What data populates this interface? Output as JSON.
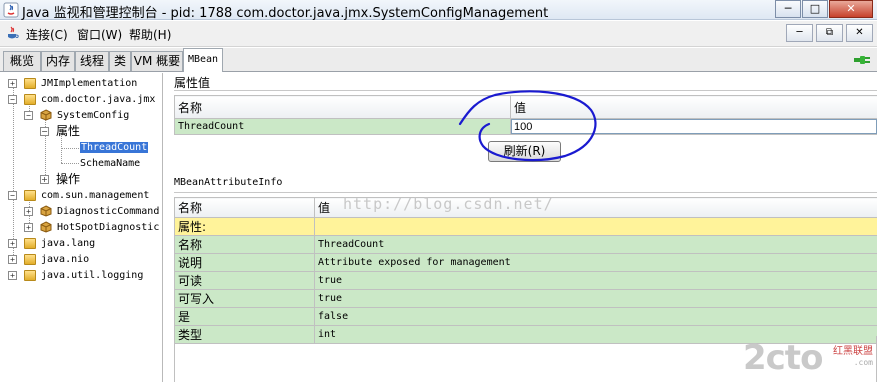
{
  "window": {
    "title": "Java 监视和管理控制台 - pid: 1788 com.doctor.java.jmx.SystemConfigManagement",
    "minimize": "─",
    "maximize": "□",
    "close": "✕"
  },
  "menubar": {
    "items": [
      "连接(C)",
      "窗口(W)",
      "帮助(H)"
    ],
    "mdi": [
      "─",
      "⧉",
      "✕"
    ]
  },
  "tabs": [
    "概览",
    "内存",
    "线程",
    "类",
    "VM 概要",
    "MBean"
  ],
  "tree": {
    "nodes": [
      "JMImplementation",
      "com.doctor.java.jmx",
      "SystemConfig",
      "属性",
      "ThreadCount",
      "SchemaName",
      "操作",
      "com.sun.management",
      "DiagnosticCommand",
      "HotSpotDiagnostic",
      "java.lang",
      "java.nio",
      "java.util.logging"
    ]
  },
  "attribute_values": {
    "section_title": "属性值",
    "col_name": "名称",
    "col_value": "值",
    "row_name": "ThreadCount",
    "row_value": "100",
    "refresh_label": "刷新(R)"
  },
  "attribute_info": {
    "section_title": "MBeanAttributeInfo",
    "col_name": "名称",
    "col_value": "值",
    "group_label": "属性:",
    "rows": [
      {
        "name": "名称",
        "value": "ThreadCount"
      },
      {
        "name": "说明",
        "value": "Attribute exposed for management"
      },
      {
        "name": "可读",
        "value": "true"
      },
      {
        "name": "可写入",
        "value": "true"
      },
      {
        "name": "是",
        "value": "false"
      },
      {
        "name": "类型",
        "value": "int"
      }
    ]
  },
  "watermark": "http://blog.csdn.net/",
  "logo": {
    "main": "2cto",
    "cn": "红黑联盟",
    "sub": ".com"
  },
  "colors": {
    "selection": "#3875d7",
    "row_green": "#cbe8c7",
    "row_yellow": "#fff39a",
    "annotation": "#1a1ad0"
  }
}
